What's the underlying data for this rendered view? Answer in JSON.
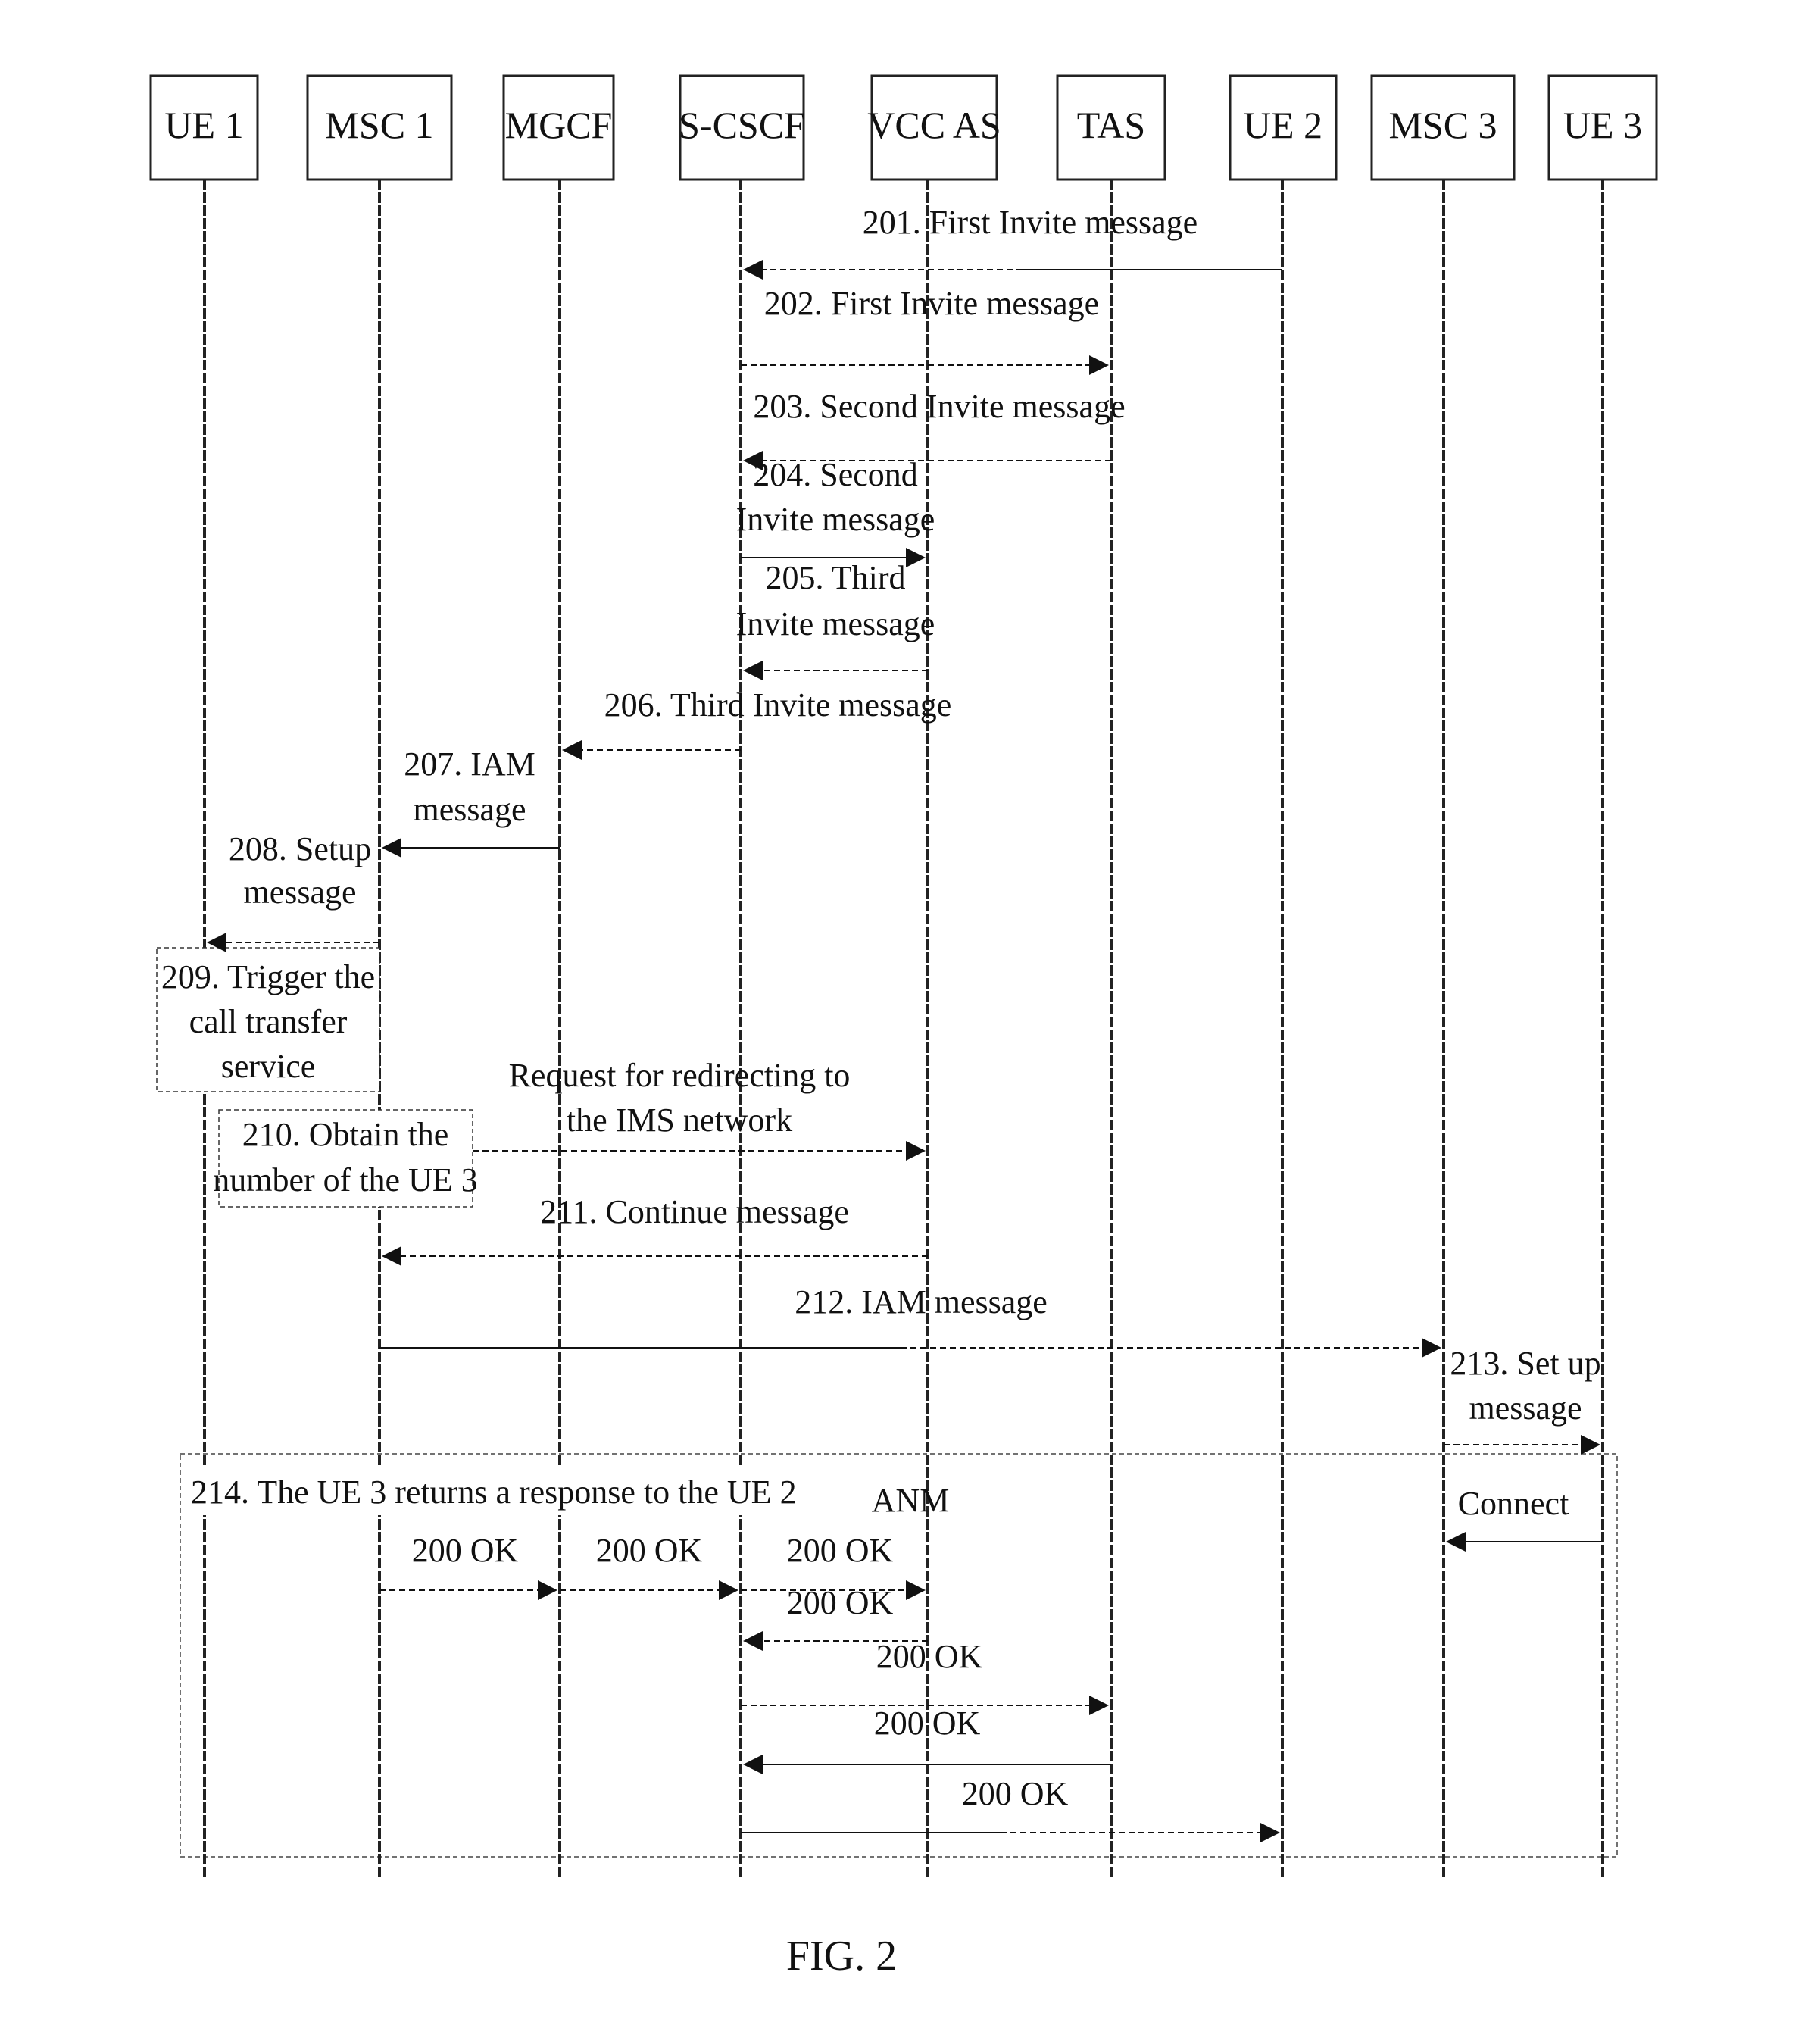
{
  "figure": {
    "caption": "FIG. 2"
  },
  "entities": [
    {
      "id": "ue1",
      "label": "UE 1"
    },
    {
      "id": "msc1",
      "label": "MSC 1"
    },
    {
      "id": "mgcf",
      "label": "MGCF"
    },
    {
      "id": "scscf",
      "label": "S-CSCF"
    },
    {
      "id": "vccas",
      "label": "VCC AS"
    },
    {
      "id": "tas",
      "label": "TAS"
    },
    {
      "id": "ue2",
      "label": "UE 2"
    },
    {
      "id": "msc3",
      "label": "MSC 3"
    },
    {
      "id": "ue3",
      "label": "UE 3"
    }
  ],
  "messages": [
    {
      "id": "m201",
      "from": "ue2",
      "to": "scscf",
      "lines": [
        "201. First Invite message"
      ],
      "style": "mixed"
    },
    {
      "id": "m202",
      "from": "scscf",
      "to": "tas",
      "lines": [
        "202. First Invite message"
      ],
      "style": "dashed"
    },
    {
      "id": "m203",
      "from": "tas",
      "to": "scscf",
      "lines": [
        "203. Second Invite message"
      ],
      "style": "dashed"
    },
    {
      "id": "m204",
      "from": "scscf",
      "to": "vccas",
      "lines": [
        "204. Second",
        "Invite message"
      ],
      "style": "solid"
    },
    {
      "id": "m205",
      "from": "vccas",
      "to": "scscf",
      "lines": [
        "205. Third",
        "Invite message"
      ],
      "style": "dashed"
    },
    {
      "id": "m206",
      "from": "scscf",
      "to": "mgcf",
      "lines": [
        "206. Third Invite message"
      ],
      "style": "dashed"
    },
    {
      "id": "m207",
      "from": "mgcf",
      "to": "msc1",
      "lines": [
        "207. IAM",
        "message"
      ],
      "style": "solid"
    },
    {
      "id": "m208",
      "from": "msc1",
      "to": "ue1",
      "lines": [
        "208. Setup",
        "message"
      ],
      "style": "dashed"
    },
    {
      "id": "mredirect",
      "from": "note210",
      "to": "vccas",
      "lines": [
        "Request for redirecting to",
        "the IMS network"
      ],
      "style": "dashed"
    },
    {
      "id": "m211",
      "from": "vccas",
      "to": "msc1",
      "lines": [
        "211. Continue message"
      ],
      "style": "dashed"
    },
    {
      "id": "m212",
      "from": "msc1",
      "to": "msc3",
      "lines": [
        "212. IAM message"
      ],
      "style": "mixed"
    },
    {
      "id": "m213",
      "from": "msc3",
      "to": "ue3",
      "lines": [
        "213. Set up",
        "message"
      ],
      "style": "dashed"
    },
    {
      "id": "mconnect",
      "from": "ue3",
      "to": "msc3",
      "lines": [
        "Connect"
      ],
      "style": "solid"
    },
    {
      "id": "manm",
      "from": "msc3",
      "to": "msc1",
      "lines": [
        "ANM"
      ],
      "style": "solid"
    },
    {
      "id": "mok1",
      "from": "msc1",
      "to": "mgcf",
      "lines": [
        "200 OK"
      ],
      "style": "dashed"
    },
    {
      "id": "mok2",
      "from": "mgcf",
      "to": "scscf",
      "lines": [
        "200 OK"
      ],
      "style": "dashed"
    },
    {
      "id": "mok3",
      "from": "scscf",
      "to": "vccas",
      "lines": [
        "200 OK"
      ],
      "style": "dashed"
    },
    {
      "id": "mok4",
      "from": "vccas",
      "to": "scscf",
      "lines": [
        "200 OK"
      ],
      "style": "dashed"
    },
    {
      "id": "mok5",
      "from": "scscf",
      "to": "tas",
      "lines": [
        "200 OK"
      ],
      "style": "dashed"
    },
    {
      "id": "mok6",
      "from": "tas",
      "to": "scscf",
      "lines": [
        "200 OK"
      ],
      "style": "solid"
    },
    {
      "id": "mok7",
      "from": "scscf",
      "to": "ue2",
      "lines": [
        "200 OK"
      ],
      "style": "mixed"
    }
  ],
  "notes": [
    {
      "id": "note209",
      "lines": [
        "209. Trigger the",
        "call transfer",
        "service"
      ]
    },
    {
      "id": "note210",
      "lines": [
        "210. Obtain the",
        "number of the UE 3"
      ]
    }
  ],
  "frame": {
    "id": "frame214",
    "label": "214. The UE 3 returns a response to the UE 2"
  }
}
